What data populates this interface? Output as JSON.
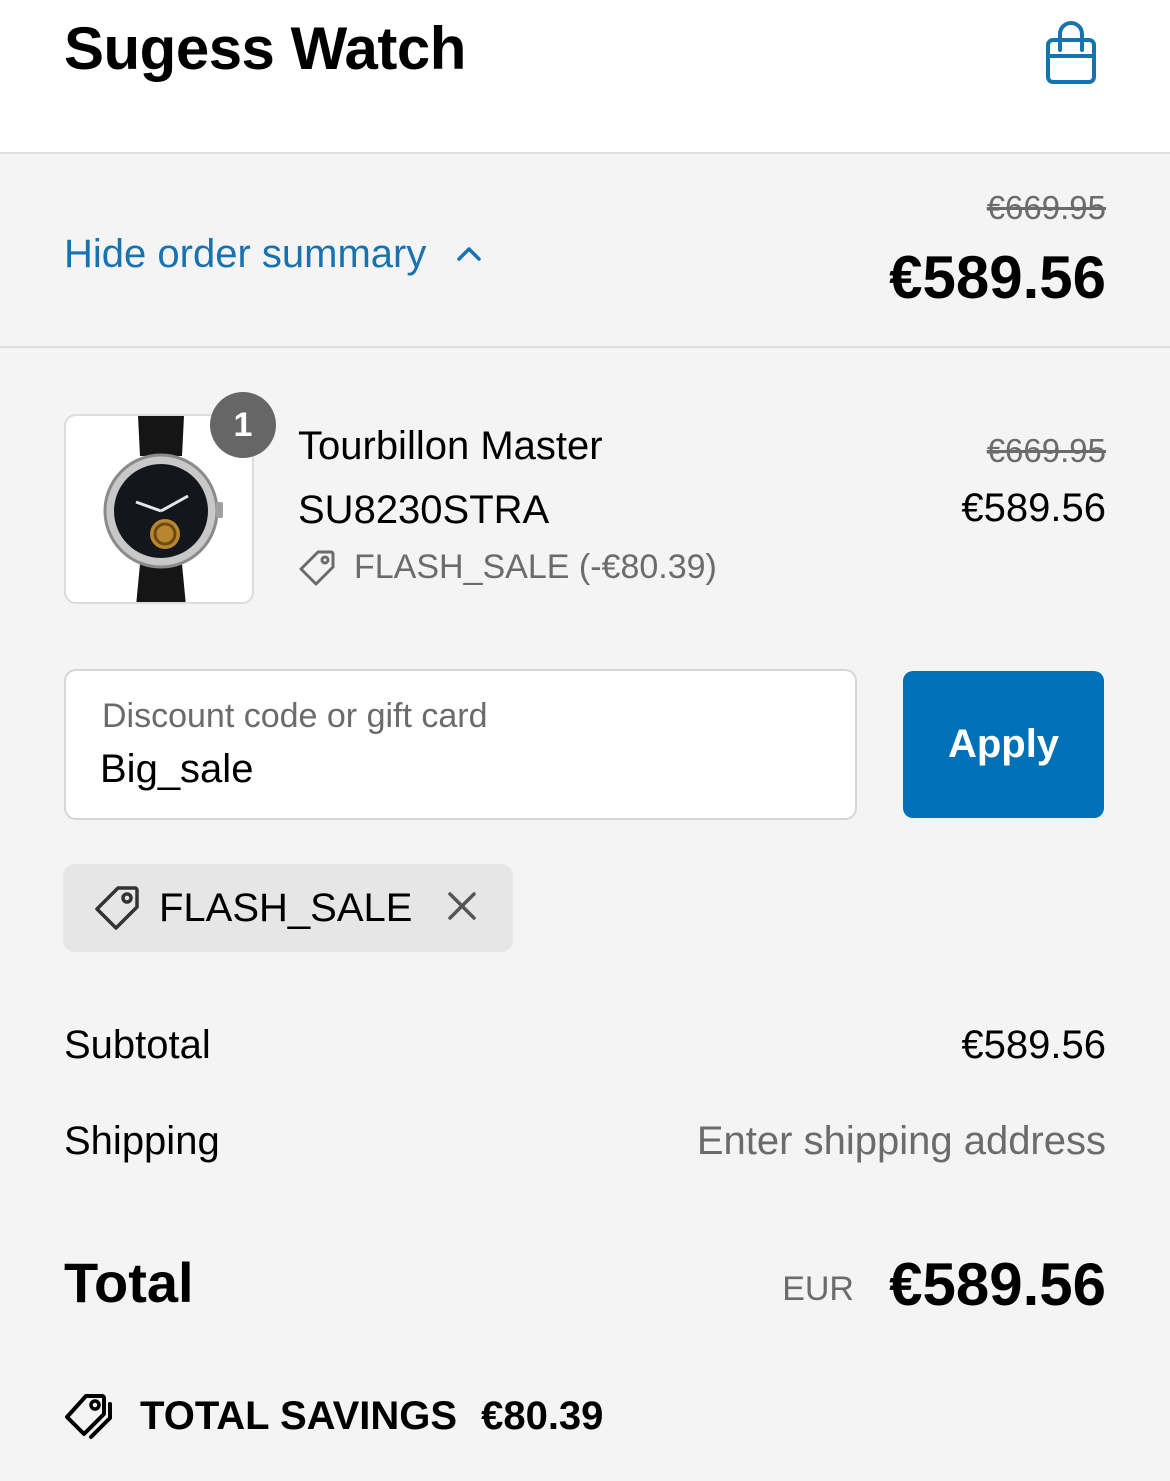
{
  "header": {
    "store_name": "Sugess Watch",
    "cart_icon": "shopping-bag-icon"
  },
  "summary_bar": {
    "toggle_label": "Hide order summary",
    "toggle_icon": "chevron-up-icon",
    "original_price": "€669.95",
    "price": "€589.56"
  },
  "line_item": {
    "quantity": "1",
    "name": "Tourbillon Master",
    "sku": "SU8230STRA",
    "discount": "FLASH_SALE (-€80.39)",
    "original_price": "€669.95",
    "price": "€589.56"
  },
  "discount_form": {
    "label": "Discount code or gift card",
    "value": "Big_sale",
    "apply_label": "Apply"
  },
  "applied_code": {
    "code": "FLASH_SALE"
  },
  "costs": {
    "subtotal_label": "Subtotal",
    "subtotal_value": "€589.56",
    "shipping_label": "Shipping",
    "shipping_value": "Enter shipping address"
  },
  "total": {
    "label": "Total",
    "currency": "EUR",
    "value": "€589.56"
  },
  "savings": {
    "label": "TOTAL SAVINGS",
    "value": "€80.39"
  },
  "colors": {
    "accent": "#1773b0",
    "button": "#0070b8",
    "background": "#f4f4f4"
  }
}
